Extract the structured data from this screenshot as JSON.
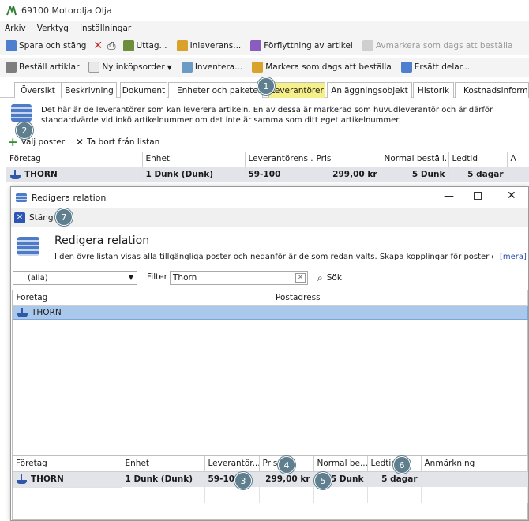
{
  "window": {
    "title": "69100 Motorolja Olja"
  },
  "menu": [
    "Arkiv",
    "Verktyg",
    "Inställningar"
  ],
  "toolbar1": {
    "save": "Spara och stäng",
    "withdraw": "Uttag...",
    "delivery": "Inleverans...",
    "move": "Förflyttning av artikel",
    "unmark": "Avmarkera som dags att beställa"
  },
  "toolbar2": {
    "order": "Beställ artiklar",
    "new_po": "Ny inköpsorder",
    "inventory": "Inventera...",
    "mark": "Markera som dags att beställa",
    "replace": "Ersätt delar..."
  },
  "tabs": [
    "Översikt",
    "Beskrivning",
    "Dokument",
    "Enheter och paketering",
    "Leverantörer",
    "Anläggningsobjekt",
    "Historik",
    "Kostnadsinformati"
  ],
  "info": {
    "text": "Det här är de leverantörer som kan leverera artikeln. En av dessa är markerad som huvudleverantör och är därför standardvärde vid inkö artikelnummer om det inte är samma som ditt eget artikelnummer."
  },
  "actions": {
    "choose": "Välj poster",
    "remove": "Ta bort från listan"
  },
  "main_grid": {
    "headers": [
      "Företag",
      "Enhet",
      "Leverantörens ...",
      "Pris",
      "Normal beställ...",
      "Ledtid",
      "A"
    ],
    "row": [
      "THORN",
      "1 Dunk (Dunk)",
      "59-100",
      "299,00 kr",
      "5 Dunk",
      "5 dagar",
      ""
    ]
  },
  "dialog": {
    "title": "Redigera relation",
    "close": "Stäng",
    "heading": "Redigera relation",
    "description": "I den övre listan visas alla tillgängliga poster och nedanför är de som redan valts. Skapa kopplingar för poster genom a...",
    "more": "[mera]",
    "dropdown": "(alla)",
    "filter_label": "Filter",
    "filter_value": "Thorn",
    "search": "Sök",
    "top_headers": [
      "Företag",
      "Postadress"
    ],
    "top_row": "THORN",
    "bottom_headers": [
      "Företag",
      "Enhet",
      "Leverantör...",
      "Pris",
      "Normal be...",
      "Ledtid",
      "Anmärkning"
    ],
    "bottom_row": [
      "THORN",
      "1 Dunk (Dunk)",
      "59-100",
      "299,00 kr",
      "5 Dunk",
      "5 dagar",
      ""
    ]
  },
  "badges": [
    "1",
    "2",
    "3",
    "4",
    "5",
    "6",
    "7"
  ],
  "colors": {
    "active_tab": "#f6f08a",
    "badge": "#5f7f8f",
    "selected_row": "#e2e4ea",
    "top_selected": "#a9c8ec"
  }
}
